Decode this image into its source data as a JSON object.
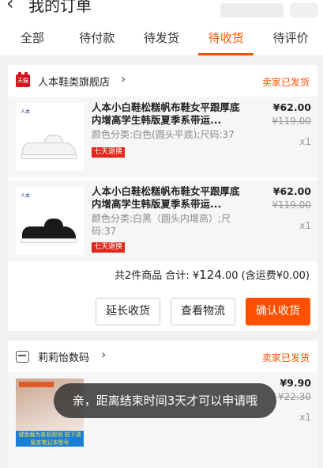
{
  "header": {
    "back_icon": "back-arrow-icon",
    "title": "我的订单"
  },
  "tabs": [
    {
      "label": "全部"
    },
    {
      "label": "待付款"
    },
    {
      "label": "待发货"
    },
    {
      "label": "待收货",
      "active": true
    },
    {
      "label": "待评价"
    }
  ],
  "orders": [
    {
      "shop_icon": "tmall-icon",
      "shop_icon_text": "天猫",
      "shop_name": "人本鞋类旗舰店",
      "status": "卖家已发货",
      "items": [
        {
          "brand_logo": "人本",
          "title": "人本小白鞋松糕帆布鞋女平跟厚底内增高学生韩版夏季系带运...",
          "spec": "颜色分类:白色(圆头平底);尺码:37",
          "tag": "七天退换",
          "price": "¥62.00",
          "original_price": "¥119.00",
          "qty": "x1",
          "shoe_color": "#f4f4f4"
        },
        {
          "brand_logo": "人本",
          "title": "人本小白鞋松糕帆布鞋女平跟厚底内增高学生韩版夏季系带运...",
          "spec": "颜色分类:白黑（圆头内增高）;尺码:37",
          "tag": "七天退换",
          "price": "¥62.00",
          "original_price": "¥119.00",
          "qty": "x1",
          "shoe_color": "#1a1a1a"
        }
      ],
      "summary": {
        "count_text": "共2件商品",
        "total_label": "合计: ",
        "total_symbol": "¥",
        "total_int": "124",
        "total_dec": ".00",
        "shipping": " (含运费¥0.00)"
      },
      "buttons": {
        "extend": "延长收货",
        "logistics": "查看物流",
        "confirm": "确认收货"
      }
    },
    {
      "shop_icon": "store-icon",
      "shop_name": "莉莉怡数码",
      "status": "卖家已发货",
      "items": [
        {
          "title": "",
          "price": "¥9.90",
          "original_price": "¥22.30",
          "qty": "x1",
          "banner": "键盘膜为各机型用 拍下请留言笔记本型号"
        }
      ]
    }
  ],
  "toast": "亲，距离结束时间3天才可以申请哦",
  "colors": {
    "accent": "#ff5000",
    "tag_red": "#e0261a"
  }
}
